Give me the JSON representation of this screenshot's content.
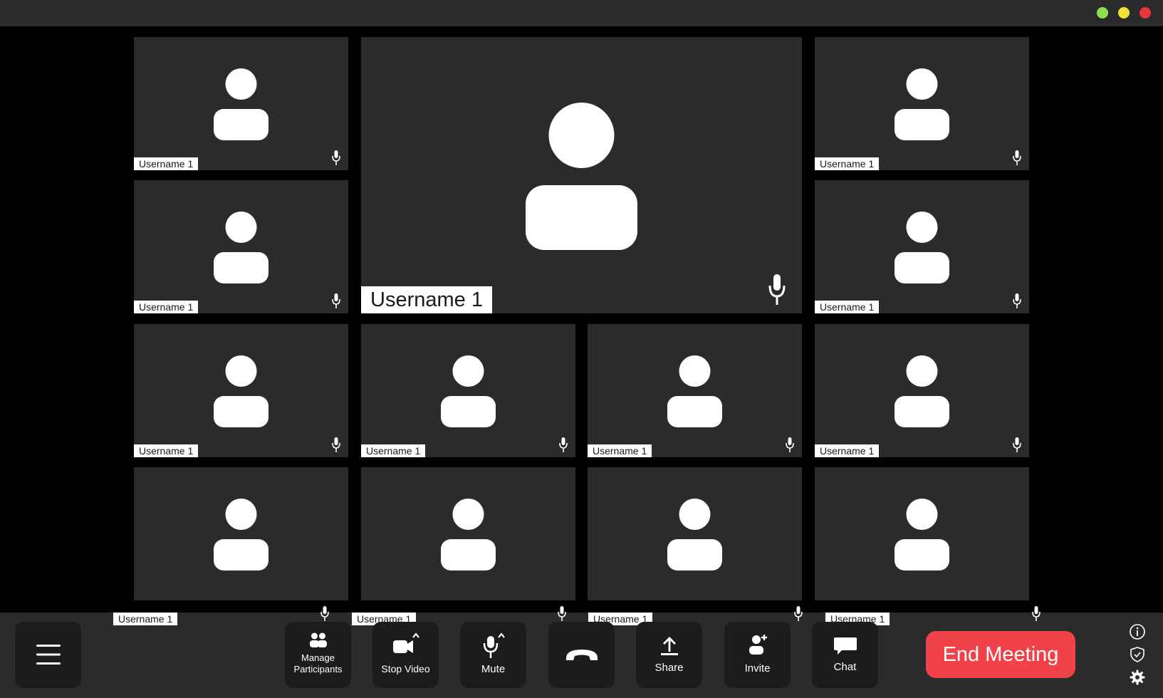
{
  "window": {
    "controls": [
      "maximize",
      "minimize",
      "close"
    ]
  },
  "featured": {
    "username": "Username 1"
  },
  "tiles": {
    "t1": {
      "username": "Username 1"
    },
    "t2": {
      "username": "Username 1"
    },
    "t3": {
      "username": "Username 1"
    },
    "t4": {
      "username": "Username 1"
    },
    "t5": {
      "username": "Username 1"
    },
    "t6": {
      "username": "Username 1"
    },
    "t7": {
      "username": "Username 1"
    },
    "t8": {
      "username": "Username 1"
    },
    "t9": {
      "username": "Username 1"
    },
    "t10": {
      "username": "Username 1"
    },
    "t11": {
      "username": "Username 1"
    },
    "t12": {
      "username": "Username 1"
    }
  },
  "toolbar": {
    "menu_icon": "hamburger-icon",
    "manage_participants_line1": "Manage",
    "manage_participants_line2": "Participants",
    "stop_video": "Stop Video",
    "mute": "Mute",
    "hangup_icon": "phone-hangup-icon",
    "share": "Share",
    "invite": "Invite",
    "chat": "Chat",
    "end_meeting": "End Meeting"
  },
  "side_icons": [
    "info-icon",
    "shield-icon",
    "gear-icon"
  ],
  "colors": {
    "background": "#000000",
    "panel": "#2b2b2b",
    "button": "#1c1c1c",
    "end_meeting": "#ef4349",
    "green": "#8ee04a",
    "yellow": "#f2e23a",
    "red": "#e8383d"
  }
}
